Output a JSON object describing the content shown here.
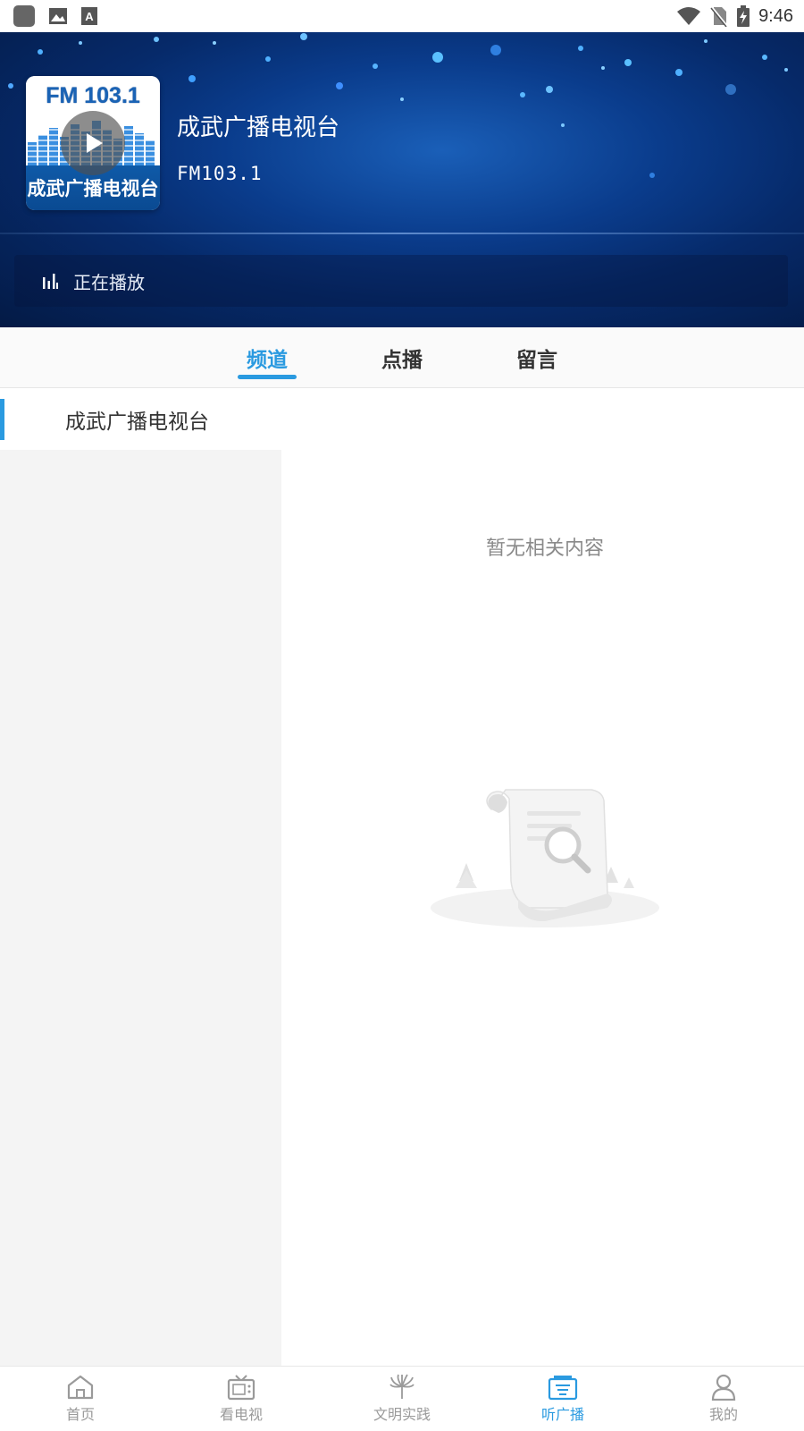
{
  "status_bar": {
    "time": "9:46",
    "left_icons": [
      "app-icon",
      "image-icon",
      "font-icon"
    ],
    "right_icons": [
      "wifi-icon",
      "no-sim-icon",
      "battery-icon"
    ]
  },
  "player": {
    "cover_fm_text": "FM 103.1",
    "cover_station_text": "成武广播电视台",
    "station_title": "成武广播电视台",
    "frequency": "FM103.1",
    "now_playing": "正在播放"
  },
  "tabs": [
    {
      "label": "频道",
      "active": true
    },
    {
      "label": "点播",
      "active": false
    },
    {
      "label": "留言",
      "active": false
    }
  ],
  "channels": [
    {
      "label": "成武广播电视台",
      "selected": true
    }
  ],
  "empty_state": {
    "text": "暂无相关内容"
  },
  "bottom_nav": [
    {
      "label": "首页",
      "icon": "home-icon",
      "active": false
    },
    {
      "label": "看电视",
      "icon": "tv-icon",
      "active": false
    },
    {
      "label": "文明实践",
      "icon": "civilization-icon",
      "active": false
    },
    {
      "label": "听广播",
      "icon": "radio-icon",
      "active": true
    },
    {
      "label": "我的",
      "icon": "user-icon",
      "active": false
    }
  ],
  "colors": {
    "accent": "#2a9ae0",
    "header_dark": "#041a45",
    "inactive_text": "#9a9a9a"
  }
}
